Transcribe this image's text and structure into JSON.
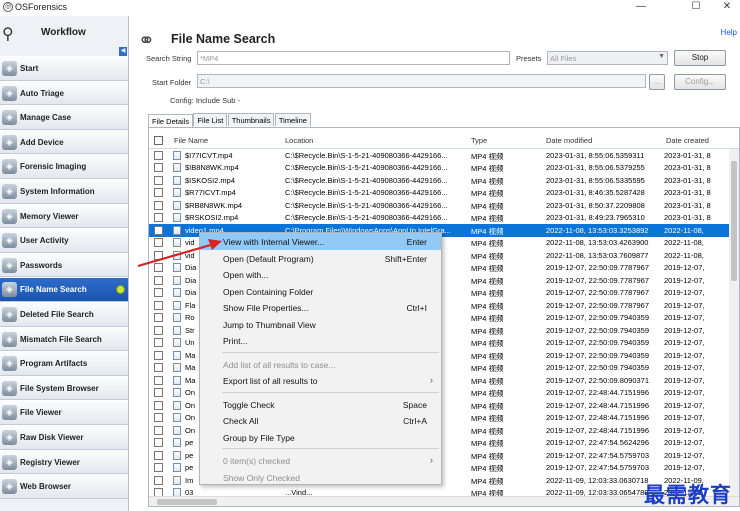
{
  "window": {
    "title": "OSForensics",
    "icon": "app-icon"
  },
  "sidebar": {
    "header": "Workflow",
    "items": [
      {
        "label": "Start",
        "icon": "start-icon"
      },
      {
        "label": "Auto Triage",
        "icon": "triage-icon"
      },
      {
        "label": "Manage Case",
        "icon": "case-icon"
      },
      {
        "label": "Add Device",
        "icon": "device-icon"
      },
      {
        "label": "Forensic Imaging",
        "icon": "imaging-icon"
      },
      {
        "label": "System Information",
        "icon": "sysinfo-icon"
      },
      {
        "label": "Memory Viewer",
        "icon": "memory-icon"
      },
      {
        "label": "User Activity",
        "icon": "activity-icon"
      },
      {
        "label": "Passwords",
        "icon": "key-icon"
      },
      {
        "label": "File Name Search",
        "icon": "binoculars-icon",
        "active": true
      },
      {
        "label": "Deleted File Search",
        "icon": "deleted-icon"
      },
      {
        "label": "Mismatch File Search",
        "icon": "mismatch-icon"
      },
      {
        "label": "Program Artifacts",
        "icon": "artifacts-icon"
      },
      {
        "label": "File System Browser",
        "icon": "browser-icon"
      },
      {
        "label": "File Viewer",
        "icon": "viewer-icon"
      },
      {
        "label": "Raw Disk Viewer",
        "icon": "disk-icon"
      },
      {
        "label": "Registry Viewer",
        "icon": "registry-icon"
      },
      {
        "label": "Web Browser",
        "icon": "web-icon"
      }
    ]
  },
  "main": {
    "title": "File Name Search",
    "help": "Help",
    "search_string_label": "Search String",
    "search_string_value": "*MP4",
    "presets_label": "Presets",
    "presets_value": "All Files",
    "stop_label": "Stop",
    "start_folder_label": "Start Folder",
    "start_folder_value": "C:\\",
    "browse_label": "...",
    "config_button_label": "Config...",
    "config_text": "Config: Include Sub -",
    "tabs": [
      "File Details",
      "File List",
      "Thumbnails",
      "Timeline"
    ],
    "columns": [
      "File Name",
      "Location",
      "Type",
      "Date modified",
      "Date created"
    ]
  },
  "rows": [
    [
      "$I77ICVT.mp4",
      "C:\\$Recycle.Bin\\S-1-5-21-409080366-4429166...",
      "MP4 视频",
      "2023-01-31, 8:55:06.5359311",
      "2023-01-31, 8"
    ],
    [
      "$IB8N8WK.mp4",
      "C:\\$Recycle.Bin\\S-1-5-21-409080366-4429166...",
      "MP4 视频",
      "2023-01-31, 8:55:06.5379255",
      "2023-01-31, 8"
    ],
    [
      "$ISKOSI2.mp4",
      "C:\\$Recycle.Bin\\S-1-5-21-409080366-4429166...",
      "MP4 视频",
      "2023-01-31, 8:55:06.5335595",
      "2023-01-31, 8"
    ],
    [
      "$R77ICVT.mp4",
      "C:\\$Recycle.Bin\\S-1-5-21-409080366-4429166...",
      "MP4 视频",
      "2023-01-31, 8:46:35.5287428",
      "2023-01-31, 8"
    ],
    [
      "$RB8N8WK.mp4",
      "C:\\$Recycle.Bin\\S-1-5-21-409080366-4429166...",
      "MP4 视频",
      "2023-01-31, 8:50:37.2209808",
      "2023-01-31, 8"
    ],
    [
      "$RSKOSI2.mp4",
      "C:\\$Recycle.Bin\\S-1-5-21-409080366-4429166...",
      "MP4 视频",
      "2023-01-31, 8:49:23.7965310",
      "2023-01-31, 8"
    ],
    [
      "video1.mp4",
      "C:\\Program Files\\WindowsApps\\AppUp.IntelGra...",
      "MP4 视频",
      "2022-11-08, 13:53:03.3253892",
      "2022-11-08,"
    ],
    [
      "vid",
      "...IntelGra...",
      "MP4 视频",
      "2022-11-08, 13:53:03.4263900",
      "2022-11-08,"
    ],
    [
      "vid",
      "...IntelGra...",
      "MP4 视频",
      "2022-11-08, 13:53:03.7609877",
      "2022-11-08,"
    ],
    [
      "Dia",
      "...SP...",
      "MP4 视频",
      "2019-12-07, 22:50:09.7787967",
      "2019-12-07,"
    ],
    [
      "Dia",
      "...SP...",
      "MP4 视频",
      "2019-12-07, 22:50:09.7787967",
      "2019-12-07,"
    ],
    [
      "Dia",
      "...SP...",
      "MP4 视频",
      "2019-12-07, 22:50:09.7787967",
      "2019-12-07,"
    ],
    [
      "Fla",
      "...SP...",
      "MP4 视频",
      "2019-12-07, 22:50:09.7787967",
      "2019-12-07,"
    ],
    [
      "Ro",
      "...SP...",
      "MP4 视频",
      "2019-12-07, 22:50:09.7940359",
      "2019-12-07,"
    ],
    [
      "Str",
      "...SP...",
      "MP4 视频",
      "2019-12-07, 22:50:09.7940359",
      "2019-12-07,"
    ],
    [
      "Un",
      "...SP...",
      "MP4 视频",
      "2019-12-07, 22:50:09.7940359",
      "2019-12-07,"
    ],
    [
      "Ma",
      "...SP...",
      "MP4 视频",
      "2019-12-07, 22:50:09.7940359",
      "2019-12-07,"
    ],
    [
      "Ma",
      "...SP...",
      "MP4 视频",
      "2019-12-07, 22:50:09.7940359",
      "2019-12-07,"
    ],
    [
      "Ma",
      "...SP...",
      "MP4 视频",
      "2019-12-07, 22:50:09.8090371",
      "2019-12-07,"
    ],
    [
      "On",
      "...ffic...",
      "MP4 视频",
      "2019-12-07, 22:48:44.7151996",
      "2019-12-07,"
    ],
    [
      "On",
      "...ffic...",
      "MP4 视频",
      "2019-12-07, 22:48:44.7151996",
      "2019-12-07,"
    ],
    [
      "On",
      "...ffic...",
      "MP4 视频",
      "2019-12-07, 22:48:44.7151996",
      "2019-12-07,"
    ],
    [
      "On",
      "...ffic...",
      "MP4 视频",
      "2019-12-07, 22:48:44.7151996",
      "2019-12-07,"
    ],
    [
      "pe",
      "...eopl...",
      "MP4 视频",
      "2019-12-07, 22:47:54.5624296",
      "2019-12-07,"
    ],
    [
      "pe",
      "...eopl...",
      "MP4 视频",
      "2019-12-07, 22:47:54.5759703",
      "2019-12-07,"
    ],
    [
      "pe",
      "...eopl...",
      "MP4 视频",
      "2019-12-07, 22:47:54.5759703",
      "2019-12-07,"
    ],
    [
      "Im",
      "...Vind...",
      "MP4 视频",
      "2022-11-09, 12:03:33.0630718",
      "2022-11-09,"
    ],
    [
      "03",
      "...Vind...",
      "MP4 视频",
      "2022-11-09, 12:03:33.0654789",
      "2022-11-09,"
    ]
  ],
  "context_menu": [
    {
      "label": "View with Internal Viewer...",
      "shortcut": "Enter",
      "highlight": true
    },
    {
      "label": "Open (Default Program)",
      "shortcut": "Shift+Enter"
    },
    {
      "label": "Open with..."
    },
    {
      "label": "Open Containing Folder"
    },
    {
      "label": "Show File Properties...",
      "shortcut": "Ctrl+I"
    },
    {
      "label": "Jump to Thumbnail View"
    },
    {
      "label": "Print..."
    },
    {
      "sep": true
    },
    {
      "label": "Add list of all results to case...",
      "disabled": true
    },
    {
      "label": "Export list of all results to",
      "submenu": true
    },
    {
      "sep": true
    },
    {
      "label": "Toggle Check",
      "shortcut": "Space"
    },
    {
      "label": "Check All",
      "shortcut": "Ctrl+A"
    },
    {
      "label": "Group by File Type"
    },
    {
      "sep": true
    },
    {
      "label": "0 item(s) checked",
      "disabled": true,
      "submenu": true
    },
    {
      "label": "Show Only Checked",
      "disabled": true
    }
  ],
  "watermark": "最需教育",
  "colors": {
    "selection": "#0a74d8",
    "menu_highlight": "#91c9f7",
    "sidebar_active": "#1a55b0",
    "arrow": "#d62323",
    "watermark": "#1b3ec5"
  }
}
